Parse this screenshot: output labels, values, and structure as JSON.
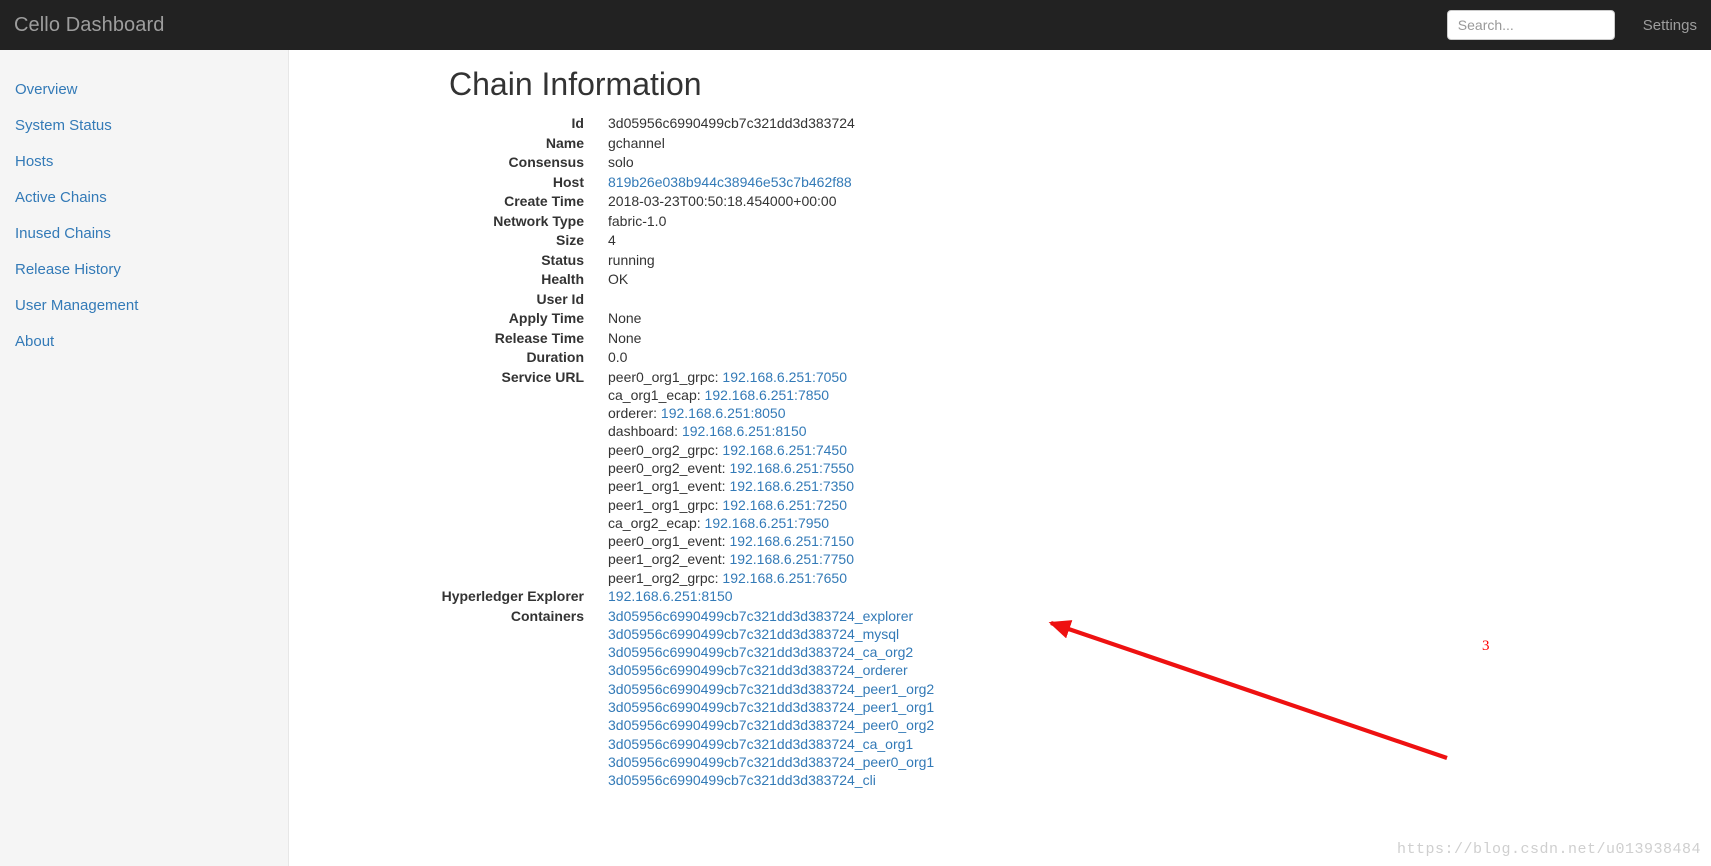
{
  "navbar": {
    "brand": "Cello Dashboard",
    "search_placeholder": "Search...",
    "search_value": "",
    "settings_label": "Settings"
  },
  "sidebar": {
    "items": [
      {
        "label": "Overview"
      },
      {
        "label": "System Status"
      },
      {
        "label": "Hosts"
      },
      {
        "label": "Active Chains"
      },
      {
        "label": "Inused Chains"
      },
      {
        "label": "Release History"
      },
      {
        "label": "User Management"
      },
      {
        "label": "About"
      }
    ]
  },
  "main": {
    "title": "Chain Information",
    "fields": {
      "id_label": "Id",
      "id_value": "3d05956c6990499cb7c321dd3d383724",
      "name_label": "Name",
      "name_value": "gchannel",
      "consensus_label": "Consensus",
      "consensus_value": "solo",
      "host_label": "Host",
      "host_value": "819b26e038b944c38946e53c7b462f88",
      "create_time_label": "Create Time",
      "create_time_value": "2018-03-23T00:50:18.454000+00:00",
      "network_type_label": "Network Type",
      "network_type_value": "fabric-1.0",
      "size_label": "Size",
      "size_value": "4",
      "status_label": "Status",
      "status_value": "running",
      "health_label": "Health",
      "health_value": "OK",
      "user_id_label": "User Id",
      "user_id_value": "",
      "apply_time_label": "Apply Time",
      "apply_time_value": "None",
      "release_time_label": "Release Time",
      "release_time_value": "None",
      "duration_label": "Duration",
      "duration_value": "0.0",
      "service_url_label": "Service URL",
      "explorer_label": "Hyperledger Explorer",
      "explorer_value": "192.168.6.251:8150",
      "containers_label": "Containers"
    },
    "service_urls": [
      {
        "name": "peer0_org1_grpc:",
        "url": "192.168.6.251:7050"
      },
      {
        "name": "ca_org1_ecap:",
        "url": "192.168.6.251:7850"
      },
      {
        "name": "orderer:",
        "url": "192.168.6.251:8050"
      },
      {
        "name": "dashboard:",
        "url": "192.168.6.251:8150"
      },
      {
        "name": "peer0_org2_grpc:",
        "url": "192.168.6.251:7450"
      },
      {
        "name": "peer0_org2_event:",
        "url": "192.168.6.251:7550"
      },
      {
        "name": "peer1_org1_event:",
        "url": "192.168.6.251:7350"
      },
      {
        "name": "peer1_org1_grpc:",
        "url": "192.168.6.251:7250"
      },
      {
        "name": "ca_org2_ecap:",
        "url": "192.168.6.251:7950"
      },
      {
        "name": "peer0_org1_event:",
        "url": "192.168.6.251:7150"
      },
      {
        "name": "peer1_org2_event:",
        "url": "192.168.6.251:7750"
      },
      {
        "name": "peer1_org2_grpc:",
        "url": "192.168.6.251:7650"
      }
    ],
    "containers": [
      "3d05956c6990499cb7c321dd3d383724_explorer",
      "3d05956c6990499cb7c321dd3d383724_mysql",
      "3d05956c6990499cb7c321dd3d383724_ca_org2",
      "3d05956c6990499cb7c321dd3d383724_orderer",
      "3d05956c6990499cb7c321dd3d383724_peer1_org2",
      "3d05956c6990499cb7c321dd3d383724_peer1_org1",
      "3d05956c6990499cb7c321dd3d383724_peer0_org2",
      "3d05956c6990499cb7c321dd3d383724_ca_org1",
      "3d05956c6990499cb7c321dd3d383724_peer0_org1",
      "3d05956c6990499cb7c321dd3d383724_cli"
    ]
  },
  "annotation": {
    "number": "3",
    "arrow_color": "#ee1111"
  },
  "watermark": "https://blog.csdn.net/u013938484",
  "colors": {
    "navbar_bg": "#222222",
    "navbar_text": "#9d9d9d",
    "sidebar_bg": "#f5f5f5",
    "link": "#337ab7",
    "body_text": "#333333",
    "annotation": "#ff0000"
  }
}
